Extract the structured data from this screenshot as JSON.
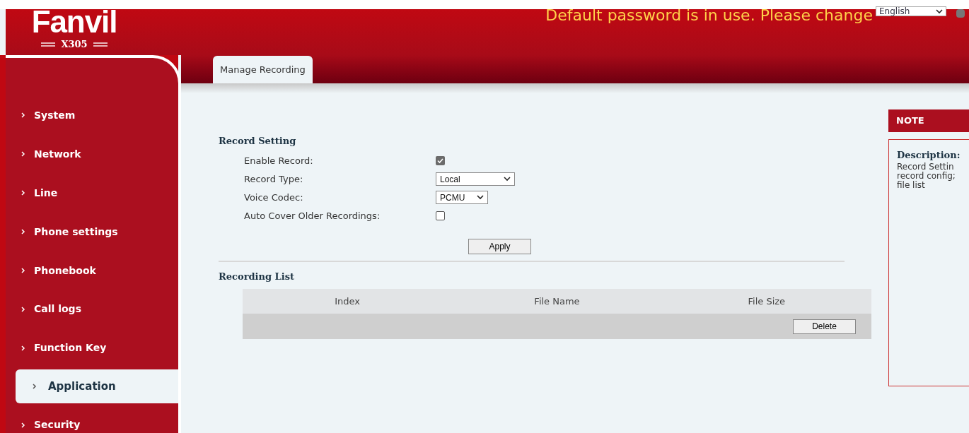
{
  "header": {
    "logo": "Fanvil",
    "model": "X305",
    "warning": "Default password is in use. Please change",
    "language": "English"
  },
  "tabs": [
    {
      "label": "Manage Recording",
      "selected": true
    }
  ],
  "sidebar": {
    "items": [
      {
        "label": "System",
        "selected": false
      },
      {
        "label": "Network",
        "selected": false
      },
      {
        "label": "Line",
        "selected": false
      },
      {
        "label": "Phone settings",
        "selected": false
      },
      {
        "label": "Phonebook",
        "selected": false
      },
      {
        "label": "Call logs",
        "selected": false
      },
      {
        "label": "Function Key",
        "selected": false
      },
      {
        "label": "Application",
        "selected": true
      },
      {
        "label": "Security",
        "selected": false
      }
    ]
  },
  "record_setting": {
    "title": "Record Setting",
    "fields": [
      {
        "kind": "checkbox",
        "label": "Enable Record:",
        "checked": true
      },
      {
        "kind": "select",
        "label": "Record Type:",
        "value": "Local",
        "wide": true
      },
      {
        "kind": "select",
        "label": "Voice Codec:",
        "value": "PCMU",
        "wide": false
      },
      {
        "kind": "checkbox",
        "label": "Auto Cover Older Recordings:",
        "checked": false
      }
    ],
    "apply": "Apply"
  },
  "recording_list": {
    "title": "Recording List",
    "columns": [
      "Index",
      "File Name",
      "File Size"
    ],
    "delete": "Delete"
  },
  "note": {
    "title": "NOTE",
    "heading": "Description:",
    "lines": [
      "Record Settin",
      "record config;",
      "file list"
    ]
  }
}
